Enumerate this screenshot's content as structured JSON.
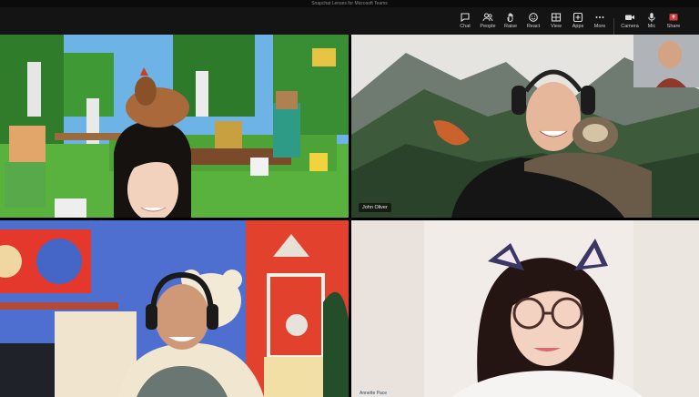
{
  "window": {
    "title": "Snapchat Lenses for Microsoft Teams"
  },
  "toolbar": {
    "items": [
      {
        "label": "Chat",
        "icon": "chat-icon"
      },
      {
        "label": "People",
        "icon": "people-icon"
      },
      {
        "label": "Raise",
        "icon": "raise-hand-icon"
      },
      {
        "label": "React",
        "icon": "react-icon"
      },
      {
        "label": "View",
        "icon": "view-icon"
      },
      {
        "label": "Apps",
        "icon": "apps-icon"
      },
      {
        "label": "More",
        "icon": "more-icon"
      },
      {
        "label": "Camera",
        "icon": "camera-icon"
      },
      {
        "label": "Mic",
        "icon": "mic-icon"
      },
      {
        "label": "Share",
        "icon": "share-icon"
      }
    ],
    "share_color": "#d43b3b"
  },
  "participants": [
    {
      "lens": "minecraft-chicken",
      "name": ""
    },
    {
      "lens": "mountain-sloth",
      "name": "John Oliver"
    },
    {
      "lens": "teddy-bear-room",
      "name": ""
    },
    {
      "lens": "cat-ears-glasses",
      "name": "Annette Pace"
    }
  ],
  "self_view": {
    "lens": "none"
  }
}
